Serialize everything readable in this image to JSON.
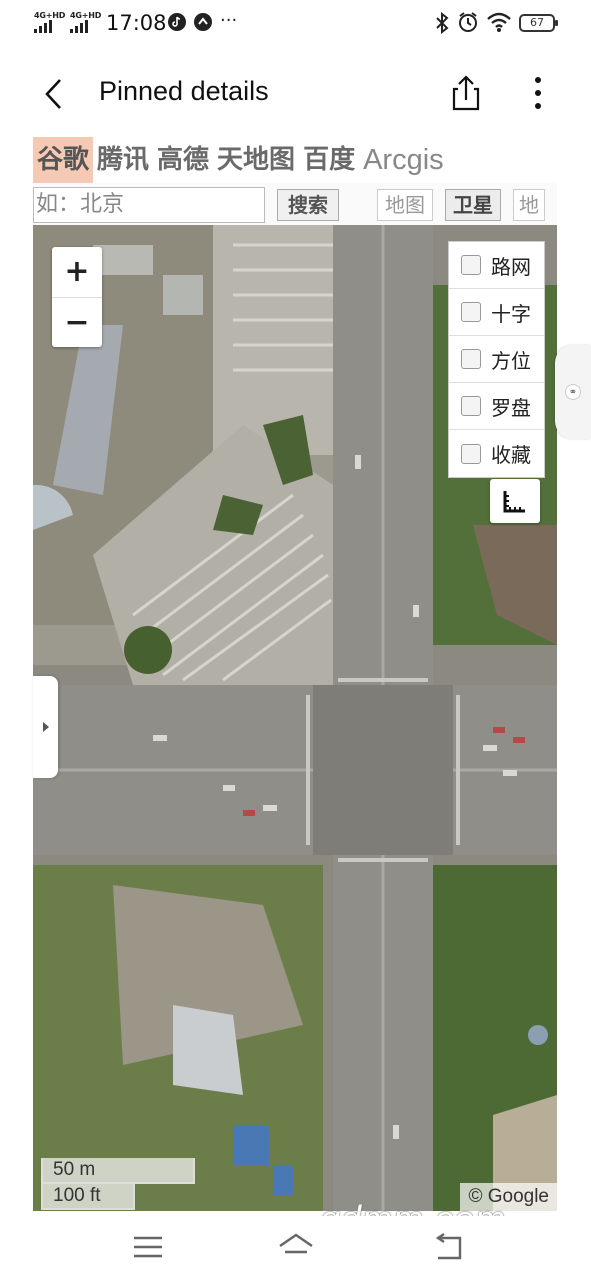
{
  "status_bar": {
    "network_1": "4G+HD",
    "network_2": "4G+HD",
    "time": "17:08",
    "more": "···",
    "battery": "67",
    "icons": [
      "bluetooth-icon",
      "alarm-icon",
      "wifi-icon",
      "battery-icon"
    ]
  },
  "header": {
    "title": "Pinned details",
    "back_icon": "chevron-left-icon",
    "share_icon": "share-icon",
    "more_icon": "more-vertical-icon"
  },
  "map_tabs": [
    {
      "label": "谷歌",
      "active": true
    },
    {
      "label": "腾讯",
      "active": false
    },
    {
      "label": "高德",
      "active": false
    },
    {
      "label": "天地图",
      "active": false
    },
    {
      "label": "百度",
      "active": false
    },
    {
      "label": "Arcgis",
      "active": false
    }
  ],
  "search": {
    "placeholder": "如：北京",
    "value": "",
    "button_label": "搜索"
  },
  "map_types": [
    {
      "label": "地图",
      "selected": false
    },
    {
      "label": "卫星",
      "selected": true
    },
    {
      "label": "地",
      "selected": false
    }
  ],
  "zoom": {
    "in": "+",
    "out": "−"
  },
  "layers": [
    {
      "label": "路网",
      "checked": false
    },
    {
      "label": "十字",
      "checked": false
    },
    {
      "label": "方位",
      "checked": false
    },
    {
      "label": "罗盘",
      "checked": false
    },
    {
      "label": "收藏",
      "checked": false
    }
  ],
  "ruler_icon": "ruler-icon",
  "scale": {
    "metric": "50 m",
    "imperial": "100 ft"
  },
  "copyright": "© Google",
  "watermark": "gdmm.com",
  "colors": {
    "active_tab_bg": "#f6c9b5",
    "road": "#8f8e88",
    "vegetation": "#4f6b3a"
  },
  "nav_icons": [
    "menu-icon",
    "home-icon",
    "back-icon"
  ]
}
